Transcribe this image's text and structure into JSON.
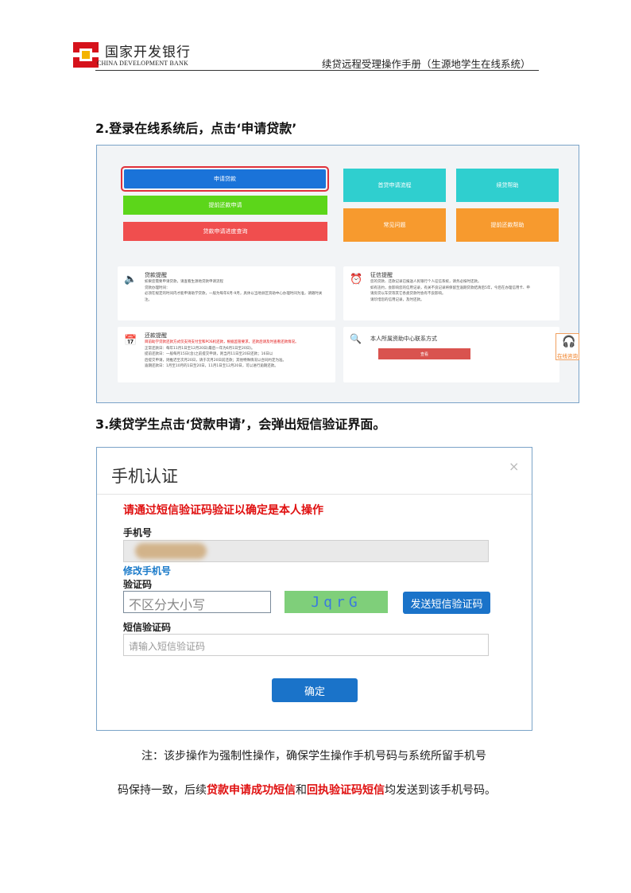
{
  "header": {
    "bank_name_cn": "国家开发银行",
    "bank_name_en": "CHINA DEVELOPMENT BANK",
    "doc_title": "续贷远程受理操作手册（生源地学生在线系统）"
  },
  "step2": {
    "title": "2.登录在线系统后，点击‘申请贷款’"
  },
  "screen1": {
    "buttons": {
      "apply": "申请贷款",
      "early_repay": "提前还款申请",
      "progress": "贷款申请进度查询",
      "first_loan_process": "首贷申请流程",
      "renew_help": "续贷帮助",
      "faq": "常见问题",
      "early_repay_help": "提前还款帮助"
    },
    "cards": {
      "loan_reminder": {
        "title": "贷款提醒",
        "lines": [
          "如果您需要申请贷款，请查看生源地贷款申请流程",
          "贷款办理时间：",
          "必须在规定的时间内才能申请助学贷款，一般为每年6月-9月，具体以当地县区资助中心办理时间为准，请随时关注。"
        ]
      },
      "credit_reminder": {
        "title": "征信提醒",
        "lines": [
          "您的贷款、还款记录已报送人民银行个人征信系统，请务必按时还款。",
          "如有违约，会影响您的信用记录，有关不良记录将保留至逾期贷款结清后5年，今后在办理信用卡、申",
          "请房贷以车贷等其它各类贷款时会有不良影响。",
          "请珍惜您的信用记录，及时还款。"
        ]
      },
      "repay_reminder": {
        "title": "还款提醒",
        "lines": [
          "目前助学贷款还款方式仅支持支付宝和POS机还款，根据监管要求，还款后请及时查看还款情况。",
          "正常还款日：每年11月1日至12月20日(最后一年为6月1日至20日)。",
          "提前还款日：一般每月15日(含)之前提交申请，则当月11日至20日还款；16日以",
          "后提交申请，则推迟至次月20日，请于次月20日前还款；其他特殊情况以合同约定为准。",
          "逾期还款日：1月至10月的1日至20日，11月1日至12月20日，可以进行逾期还款。"
        ]
      },
      "contact": {
        "title": "本人所属资助中心联系方式",
        "button": "查看"
      }
    },
    "online_service": "在线咨询"
  },
  "step3": {
    "title": "3.续贷学生点击‘贷款申请’，会弹出短信验证界面。"
  },
  "screen2": {
    "dialog_title": "手机认证",
    "close": "×",
    "warning": "请通过短信验证码验证以确定是本人操作",
    "phone_label": "手机号",
    "modify_phone": "修改手机号",
    "captcha_label": "验证码",
    "captcha_placeholder": "不区分大小写",
    "captcha_text": "JqrG",
    "send_sms": "发送短信验证码",
    "sms_label": "短信验证码",
    "sms_placeholder": "请输入短信验证码",
    "confirm": "确定"
  },
  "note": {
    "line1": "注：该步操作为强制性操作，确保学生操作手机号码与系统所留手机号",
    "line2_a": "码保持一致，后续",
    "line2_b": "贷款申请成功短信",
    "line2_c": "和",
    "line2_d": "回执验证码短信",
    "line2_e": "均发送到该手机号码。"
  },
  "colors": {
    "blue": "#1a73d9",
    "green": "#5cd61a",
    "red": "#f04e4e",
    "teal": "#2fcfcf",
    "orange": "#f79a2e",
    "warn": "#e01010",
    "link": "#1a7ac9"
  }
}
